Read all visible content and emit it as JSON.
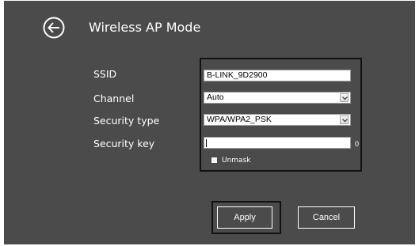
{
  "header": {
    "title": "Wireless AP Mode",
    "back_icon": "back-arrow-icon"
  },
  "form": {
    "ssid": {
      "label": "SSID",
      "value": "B-LINK_9D2900"
    },
    "channel": {
      "label": "Channel",
      "value": "Auto"
    },
    "security_type": {
      "label": "Security type",
      "value": "WPA/WPA2_PSK"
    },
    "security_key": {
      "label": "Security key",
      "value": "",
      "length": "0"
    },
    "unmask": {
      "label": "Unmask",
      "checked": false
    }
  },
  "buttons": {
    "apply": "Apply",
    "cancel": "Cancel"
  },
  "colors": {
    "background": "#4b4b4b",
    "text": "#ffffff",
    "frame": "#111111"
  }
}
